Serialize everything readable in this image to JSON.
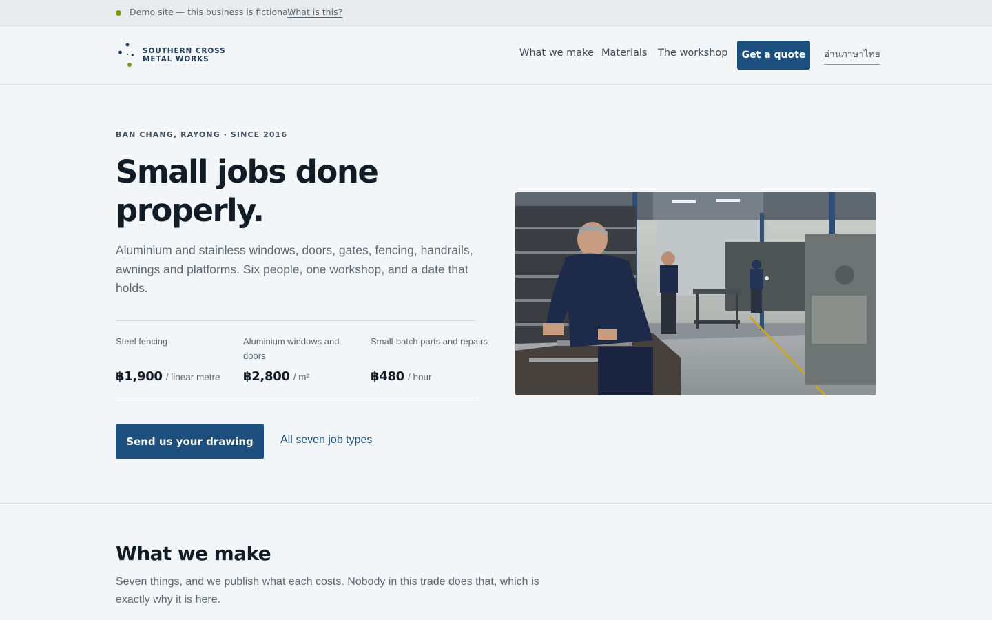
{
  "demo_banner": {
    "text": "Demo site — this business is fictional.",
    "link": "What is this?",
    "dot_color": "#7b9a16"
  },
  "header": {
    "logo_icon": "dot-constellation-icon",
    "logo_line1": "SOUTHERN CROSS",
    "logo_line2": "METAL WORKS",
    "nav": [
      {
        "label": "What we make"
      },
      {
        "label": "Materials"
      },
      {
        "label": "The workshop"
      }
    ],
    "quote_button": "Get a quote",
    "language_link": "อ่านภาษาไทย"
  },
  "hero": {
    "eyebrow": "BAN CHANG, RAYONG · SINCE 2016",
    "title": "Small jobs done properly.",
    "subtitle": "Aluminium and stainless windows, doors, gates, fencing, handrails, awnings and platforms. Six people, one workshop, and a date that holds.",
    "prices": [
      {
        "label": "Steel fencing",
        "value": "฿1,900",
        "unit": "/ linear metre"
      },
      {
        "label": "Aluminium windows and doors",
        "value": "฿2,800",
        "unit": "/ m²"
      },
      {
        "label": "Small-batch parts and repairs",
        "value": "฿480",
        "unit": "/ hour"
      }
    ],
    "cta_button": "Send us your drawing",
    "cta_link": "All seven job types"
  },
  "section": {
    "title": "What we make",
    "subtitle": "Seven things, and we publish what each costs. Nobody in this trade does that, which is exactly why it is here."
  },
  "colors": {
    "brand": "#1d4f7e",
    "accent": "#7b9a16",
    "background": "#f3f6f8"
  }
}
